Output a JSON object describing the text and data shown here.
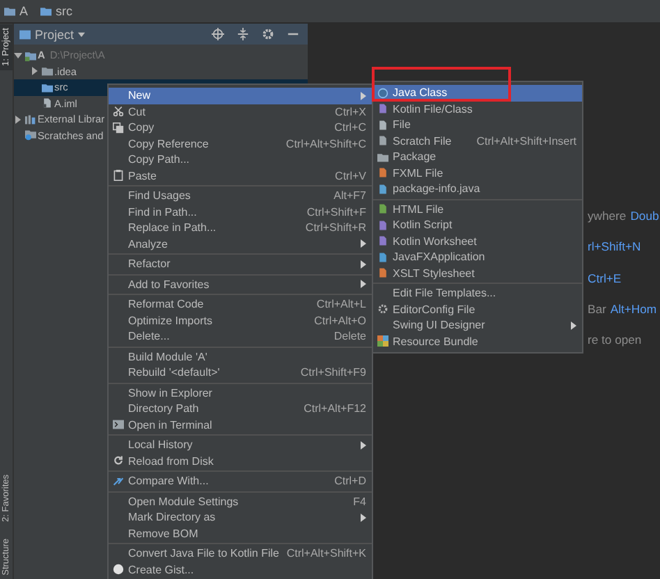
{
  "breadcrumb": [
    "A",
    "src"
  ],
  "top_tabs": [
    {
      "label": "1: Project",
      "selected": true
    }
  ],
  "bottom_tabs": [
    {
      "label": "2: Favorites",
      "selected": false
    },
    {
      "label": "Structure",
      "selected": false
    }
  ],
  "project_panel": {
    "title": "Project",
    "tree": [
      {
        "label": "A",
        "path": "D:\\Project\\A",
        "kind": "module",
        "expanded": true,
        "selected": false,
        "children": [
          {
            "label": ".idea",
            "kind": "folder",
            "expanded": false,
            "selected": false
          },
          {
            "label": "src",
            "kind": "source",
            "selected": true
          },
          {
            "label": "A.iml",
            "kind": "file",
            "selected": false
          }
        ]
      },
      {
        "label": "External Librar",
        "kind": "library",
        "expanded": false,
        "selected": false
      },
      {
        "label": "Scratches and",
        "kind": "scratch",
        "selected": false
      }
    ]
  },
  "editor_hints": [
    [
      {
        "text": "ywhere",
        "kind": "plain"
      },
      {
        "text": "Doub",
        "kind": "shortcut"
      }
    ],
    [
      {
        "text": "rl+Shift+N",
        "kind": "shortcut"
      }
    ],
    [
      {
        "text": "Ctrl+E",
        "kind": "shortcut"
      }
    ],
    [
      {
        "text": "Bar",
        "kind": "plain"
      },
      {
        "text": "Alt+Hom",
        "kind": "shortcut"
      }
    ],
    [
      {
        "text": "re to open",
        "kind": "plain"
      }
    ]
  ],
  "context_menu": {
    "groups": [
      [
        {
          "label": "New",
          "submenu": true,
          "selected": true
        },
        {
          "label": "Cut",
          "shortcut": "Ctrl+X",
          "selected": false
        },
        {
          "label": "Copy",
          "shortcut": "Ctrl+C",
          "selected": false
        },
        {
          "label": "Copy Reference",
          "shortcut": "Ctrl+Alt+Shift+C",
          "selected": false
        },
        {
          "label": "Copy Path...",
          "selected": false
        },
        {
          "label": "Paste",
          "shortcut": "Ctrl+V",
          "selected": false
        }
      ],
      [
        {
          "label": "Find Usages",
          "shortcut": "Alt+F7",
          "selected": false
        },
        {
          "label": "Find in Path...",
          "shortcut": "Ctrl+Shift+F",
          "selected": false
        },
        {
          "label": "Replace in Path...",
          "shortcut": "Ctrl+Shift+R",
          "selected": false
        },
        {
          "label": "Analyze",
          "submenu": true,
          "selected": false
        }
      ],
      [
        {
          "label": "Refactor",
          "submenu": true,
          "selected": false
        }
      ],
      [
        {
          "label": "Add to Favorites",
          "submenu": true,
          "selected": false
        }
      ],
      [
        {
          "label": "Reformat Code",
          "shortcut": "Ctrl+Alt+L",
          "selected": false
        },
        {
          "label": "Optimize Imports",
          "shortcut": "Ctrl+Alt+O",
          "selected": false
        },
        {
          "label": "Delete...",
          "shortcut": "Delete",
          "selected": false
        }
      ],
      [
        {
          "label": "Build Module 'A'",
          "selected": false
        },
        {
          "label": "Rebuild '<default>'",
          "shortcut": "Ctrl+Shift+F9",
          "selected": false
        }
      ],
      [
        {
          "label": "Show in Explorer",
          "selected": false
        },
        {
          "label": "Directory Path",
          "shortcut": "Ctrl+Alt+F12",
          "selected": false
        },
        {
          "label": "Open in Terminal",
          "selected": false
        }
      ],
      [
        {
          "label": "Local History",
          "submenu": true,
          "selected": false
        },
        {
          "label": "Reload from Disk",
          "selected": false
        }
      ],
      [
        {
          "label": "Compare With...",
          "shortcut": "Ctrl+D",
          "selected": false
        }
      ],
      [
        {
          "label": "Open Module Settings",
          "shortcut": "F4",
          "selected": false
        },
        {
          "label": "Mark Directory as",
          "submenu": true,
          "selected": false
        },
        {
          "label": "Remove BOM",
          "selected": false
        }
      ],
      [
        {
          "label": "Convert Java File to Kotlin File",
          "shortcut": "Ctrl+Alt+Shift+K",
          "selected": false
        },
        {
          "label": "Create Gist...",
          "selected": false
        }
      ]
    ]
  },
  "new_submenu": {
    "groups": [
      [
        {
          "label": "Java Class",
          "selected": true,
          "marked": true
        },
        {
          "label": "Kotlin File/Class",
          "selected": false,
          "marked": false
        },
        {
          "label": "File",
          "selected": false,
          "marked": false
        },
        {
          "label": "Scratch File",
          "shortcut": "Ctrl+Alt+Shift+Insert",
          "selected": false,
          "marked": false
        },
        {
          "label": "Package",
          "selected": false,
          "marked": false
        },
        {
          "label": "FXML File",
          "selected": false,
          "marked": false
        },
        {
          "label": "package-info.java",
          "selected": false,
          "marked": false
        }
      ],
      [
        {
          "label": "HTML File",
          "selected": false,
          "marked": false
        },
        {
          "label": "Kotlin Script",
          "selected": false,
          "marked": false
        },
        {
          "label": "Kotlin Worksheet",
          "selected": false,
          "marked": false
        },
        {
          "label": "JavaFXApplication",
          "selected": false,
          "marked": false
        },
        {
          "label": "XSLT Stylesheet",
          "selected": false,
          "marked": false
        }
      ],
      [
        {
          "label": "Edit File Templates...",
          "selected": false,
          "marked": false
        },
        {
          "label": "EditorConfig File",
          "selected": false,
          "marked": false
        },
        {
          "label": "Swing UI Designer",
          "submenu": true,
          "selected": false,
          "marked": false
        },
        {
          "label": "Resource Bundle",
          "selected": false,
          "marked": false
        }
      ]
    ]
  }
}
